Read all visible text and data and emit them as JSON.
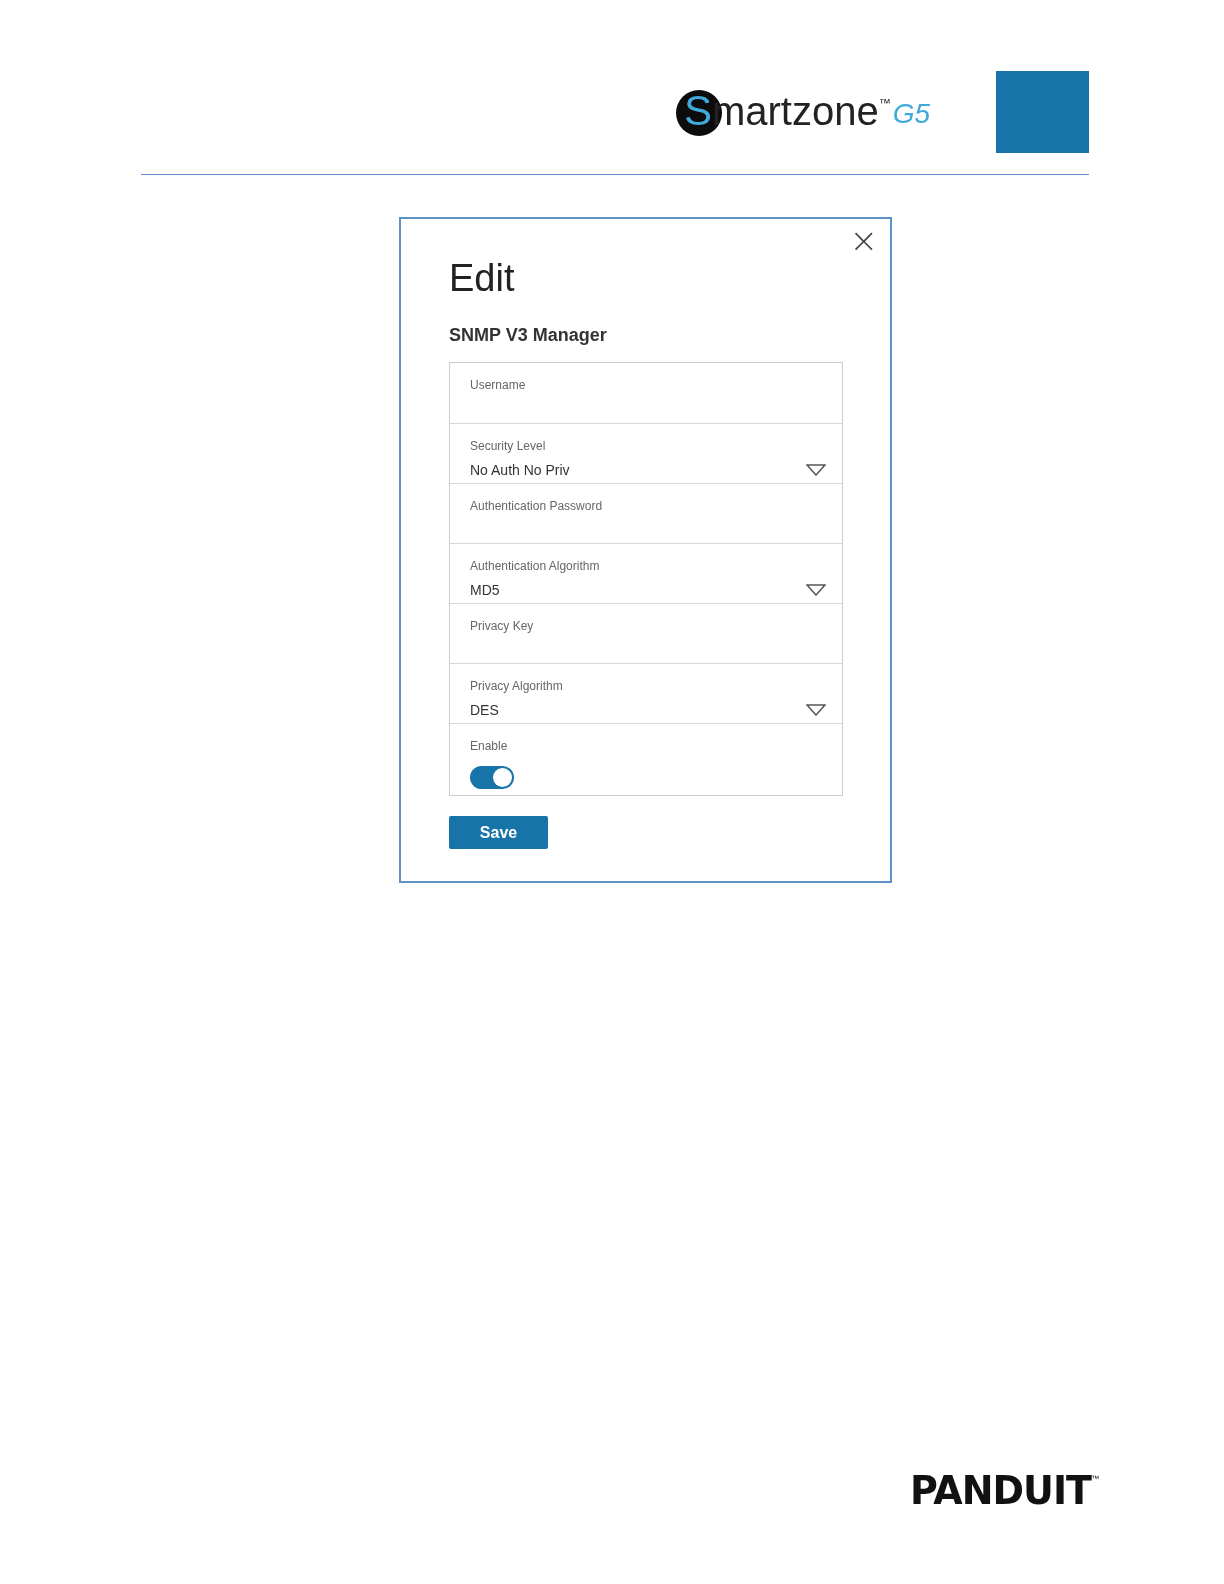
{
  "header": {
    "logo": {
      "initial": "S",
      "rest": "martzone",
      "trademark": "™",
      "model": "G5"
    }
  },
  "dialog": {
    "close": "×",
    "title": "Edit",
    "subtitle": "SNMP V3 Manager",
    "fields": [
      {
        "kind": "text",
        "label": "Username"
      },
      {
        "kind": "select",
        "label": "Security Level",
        "value": "No Auth No Priv"
      },
      {
        "kind": "text",
        "label": "Authentication Password"
      },
      {
        "kind": "select",
        "label": "Authentication Algorithm",
        "value": "MD5"
      },
      {
        "kind": "text",
        "label": "Privacy Key"
      },
      {
        "kind": "select",
        "label": "Privacy Algorithm",
        "value": "DES"
      },
      {
        "kind": "toggle",
        "label": "Enable",
        "on": true
      }
    ],
    "save_button": "Save"
  },
  "footer": {
    "logo": {
      "name": "PANDUIT",
      "trademark": "™"
    }
  }
}
